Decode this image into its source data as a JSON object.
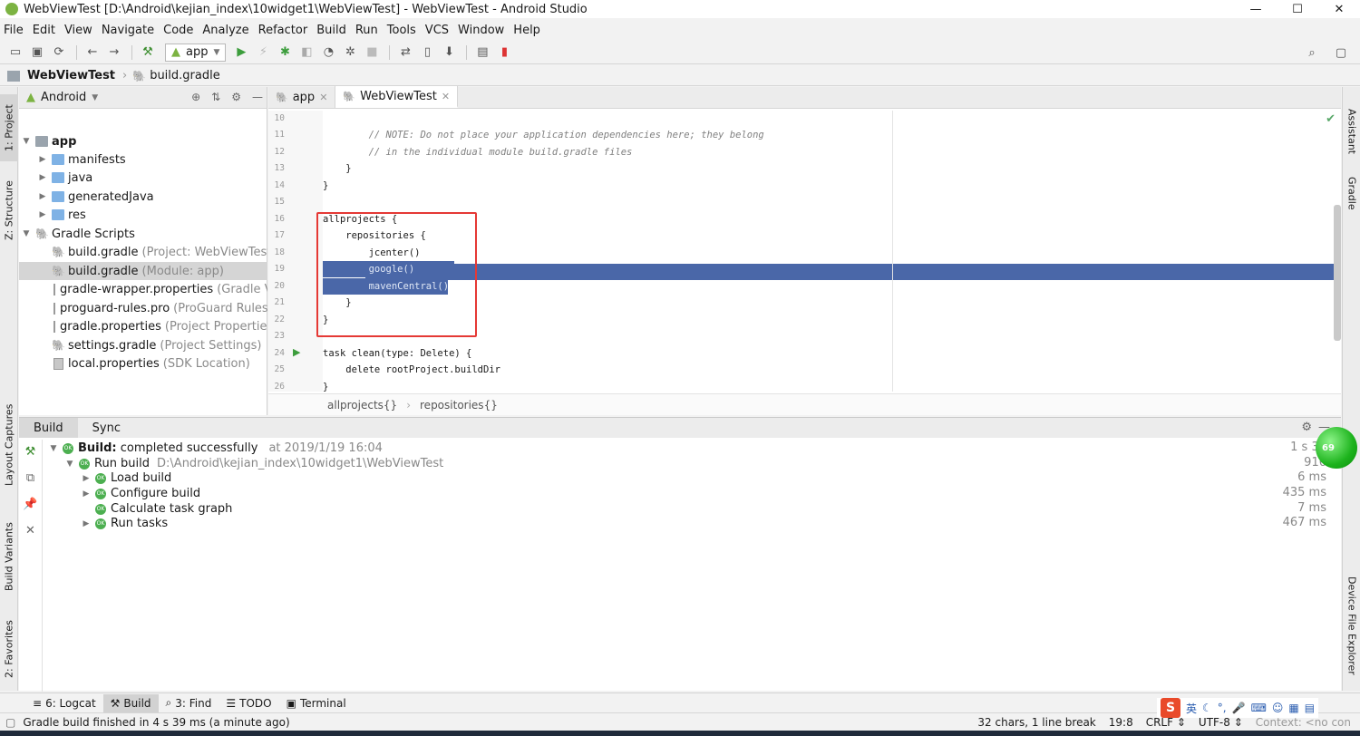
{
  "window": {
    "title": "WebViewTest [D:\\Android\\kejian_index\\10widget1\\WebViewTest] - WebViewTest - Android Studio",
    "controls": [
      "—",
      "☐",
      "✕"
    ]
  },
  "menu": [
    "File",
    "Edit",
    "View",
    "Navigate",
    "Code",
    "Analyze",
    "Refactor",
    "Build",
    "Run",
    "Tools",
    "VCS",
    "Window",
    "Help"
  ],
  "toolbar": {
    "run_config": "app"
  },
  "navbar": {
    "crumbs": [
      "WebViewTest",
      "build.gradle"
    ]
  },
  "left_strip": [
    "1: Project",
    "Z: Structure",
    "Layout Captures",
    "Build Variants",
    "2: Favorites"
  ],
  "right_strip": [
    "Assistant",
    "Gradle",
    "Device File Explorer"
  ],
  "project_panel": {
    "view_mode": "Android",
    "tree": [
      {
        "label": "app",
        "note": ""
      },
      {
        "label": "manifests",
        "note": ""
      },
      {
        "label": "java",
        "note": ""
      },
      {
        "label": "generatedJava",
        "note": ""
      },
      {
        "label": "res",
        "note": ""
      },
      {
        "label": "Gradle Scripts",
        "note": ""
      },
      {
        "label": "build.gradle",
        "note": "(Project: WebViewTest)"
      },
      {
        "label": "build.gradle",
        "note": "(Module: app)"
      },
      {
        "label": "gradle-wrapper.properties",
        "note": "(Gradle Ver"
      },
      {
        "label": "proguard-rules.pro",
        "note": "(ProGuard Rules fo"
      },
      {
        "label": "gradle.properties",
        "note": "(Project Properties)"
      },
      {
        "label": "settings.gradle",
        "note": "(Project Settings)"
      },
      {
        "label": "local.properties",
        "note": "(SDK Location)"
      }
    ]
  },
  "editor": {
    "tabs": [
      "app",
      "WebViewTest"
    ],
    "lines": [
      {
        "n": "10",
        "t": ""
      },
      {
        "n": "11",
        "t": "        // NOTE: Do not place your application dependencies here; they belong"
      },
      {
        "n": "12",
        "t": "        // in the individual module build.gradle files"
      },
      {
        "n": "13",
        "t": "    }"
      },
      {
        "n": "14",
        "t": "}"
      },
      {
        "n": "15",
        "t": ""
      },
      {
        "n": "16",
        "t": "allprojects {"
      },
      {
        "n": "17",
        "t": "    repositories {"
      },
      {
        "n": "18",
        "t": "        jcenter()"
      },
      {
        "n": "19",
        "t": "        google()"
      },
      {
        "n": "20",
        "t": "        mavenCentral()"
      },
      {
        "n": "21",
        "t": "    }"
      },
      {
        "n": "22",
        "t": "}"
      },
      {
        "n": "23",
        "t": ""
      },
      {
        "n": "24",
        "t": "task clean(type: Delete) {"
      },
      {
        "n": "25",
        "t": "    delete rootProject.buildDir"
      },
      {
        "n": "26",
        "t": "}"
      }
    ],
    "breadcrumbs": [
      "allprojects{}",
      "repositories{}"
    ]
  },
  "build_panel": {
    "tabs": [
      "Build",
      "Sync"
    ],
    "rows": [
      {
        "label": "Build:",
        "rest": "completed successfully",
        "extra": "at 2019/1/19 16:04",
        "time": "1 s 32"
      },
      {
        "label": "Run build",
        "rest": "",
        "extra": "D:\\Android\\kejian_index\\10widget1\\WebViewTest",
        "time": "916"
      },
      {
        "label": "Load build",
        "rest": "",
        "extra": "",
        "time": "6 ms"
      },
      {
        "label": "Configure build",
        "rest": "",
        "extra": "",
        "time": "435 ms"
      },
      {
        "label": "Calculate task graph",
        "rest": "",
        "extra": "",
        "time": "7 ms"
      },
      {
        "label": "Run tasks",
        "rest": "",
        "extra": "",
        "time": "467 ms"
      }
    ],
    "overlay_badge": "69"
  },
  "bottom_tabs": [
    "6: Logcat",
    "Build",
    "3: Find",
    "TODO",
    "Terminal"
  ],
  "status": {
    "message": "Gradle build finished in 4 s 39 ms (a minute ago)",
    "selection": "32 chars, 1 line break",
    "position": "19:8",
    "line_sep": "CRLF ⇕",
    "encoding": "UTF-8 ⇕",
    "context": "Context: <no con"
  },
  "ime": {
    "logo": "S",
    "lang": "英"
  }
}
